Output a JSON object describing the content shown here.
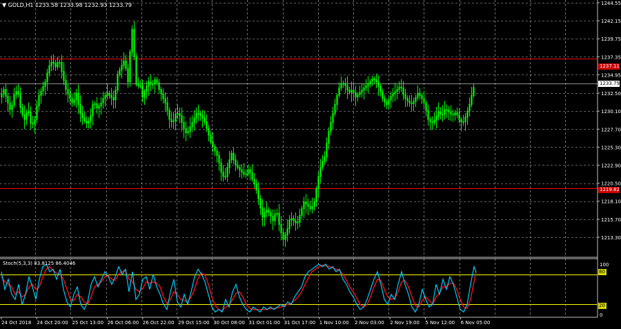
{
  "header": {
    "symbol_label": "GOLD,H1",
    "quotes": [
      "1233.58",
      "1233.98",
      "1232.93",
      "1233.79"
    ]
  },
  "stoch": {
    "label": "Stoch(5,3,3) 83.8125 86.4046",
    "levels": [
      80,
      20
    ],
    "level_labels": [
      "80",
      "20"
    ],
    "scale_labels": [
      "100",
      "0"
    ],
    "k_color": "#00ccff",
    "d_color": "#ff1010",
    "level_color": "#ffff00"
  },
  "colors": {
    "background": "#000000",
    "grid": "#c0c0c0",
    "candle": "#00ff00",
    "hline": "#ff0000"
  },
  "price_boxes": {
    "upper_red": "1237.11",
    "current": "1233.79",
    "lower_red": "1219.82"
  },
  "chart_data": {
    "type": "candlestick",
    "y_tick_labels": [
      "1244.55",
      "1242.15",
      "1239.75",
      "1237.35",
      "1234.95",
      "1232.50",
      "1230.10",
      "1227.70",
      "1225.30",
      "1222.90",
      "1220.50",
      "1218.10",
      "1215.70",
      "1213.30"
    ],
    "ylim": [
      1210.9,
      1244.55
    ],
    "x_tick_labels": [
      "24 Oct 2018",
      "24 Oct 20:00",
      "25 Oct 13:00",
      "26 Oct 06:00",
      "26 Oct 22:00",
      "29 Oct 15:00",
      "30 Oct 08:00",
      "31 Oct 01:00",
      "31 Oct 17:00",
      "1 Nov 10:00",
      "2 Nov 03:00",
      "2 Nov 19:00",
      "5 Nov 12:00",
      "6 Nov 05:00"
    ],
    "horizontal_lines": [
      1237.11,
      1219.82
    ],
    "current_price": 1233.79,
    "close_path": [
      [
        0,
        1232.0
      ],
      [
        5,
        1233.0
      ],
      [
        10,
        1231.5
      ],
      [
        15,
        1230.0
      ],
      [
        20,
        1232.3
      ],
      [
        25,
        1233.0
      ],
      [
        30,
        1230.0
      ],
      [
        35,
        1229.0
      ],
      [
        40,
        1230.5
      ],
      [
        45,
        1228.0
      ],
      [
        50,
        1229.0
      ],
      [
        55,
        1232.0
      ],
      [
        60,
        1233.0
      ],
      [
        65,
        1234.0
      ],
      [
        70,
        1236.0
      ],
      [
        75,
        1236.8
      ],
      [
        80,
        1236.0
      ],
      [
        85,
        1237.0
      ],
      [
        90,
        1235.0
      ],
      [
        95,
        1233.0
      ],
      [
        100,
        1232.0
      ],
      [
        105,
        1231.0
      ],
      [
        110,
        1232.5
      ],
      [
        115,
        1230.0
      ],
      [
        120,
        1229.0
      ],
      [
        125,
        1228.5
      ],
      [
        130,
        1229.0
      ],
      [
        135,
        1231.5
      ],
      [
        140,
        1230.5
      ],
      [
        145,
        1231.0
      ],
      [
        150,
        1232.0
      ],
      [
        155,
        1232.5
      ],
      [
        160,
        1232.0
      ],
      [
        165,
        1231.5
      ],
      [
        170,
        1235.0
      ],
      [
        175,
        1236.0
      ],
      [
        180,
        1237.0
      ],
      [
        185,
        1234.0
      ],
      [
        188,
        1238.0
      ],
      [
        192,
        1242.0
      ],
      [
        195,
        1235.0
      ],
      [
        198,
        1233.0
      ],
      [
        202,
        1234.0
      ],
      [
        206,
        1232.0
      ],
      [
        210,
        1233.0
      ],
      [
        215,
        1234.0
      ],
      [
        220,
        1233.5
      ],
      [
        225,
        1234.5
      ],
      [
        230,
        1233.0
      ],
      [
        235,
        1232.0
      ],
      [
        240,
        1231.0
      ],
      [
        245,
        1229.0
      ],
      [
        250,
        1228.5
      ],
      [
        255,
        1230.0
      ],
      [
        260,
        1229.5
      ],
      [
        265,
        1228.0
      ],
      [
        270,
        1227.0
      ],
      [
        275,
        1228.0
      ],
      [
        280,
        1229.0
      ],
      [
        285,
        1230.0
      ],
      [
        290,
        1229.5
      ],
      [
        295,
        1229.0
      ],
      [
        300,
        1227.5
      ],
      [
        305,
        1226.0
      ],
      [
        310,
        1225.0
      ],
      [
        315,
        1224.0
      ],
      [
        320,
        1222.0
      ],
      [
        325,
        1221.0
      ],
      [
        330,
        1223.0
      ],
      [
        335,
        1224.5
      ],
      [
        340,
        1223.0
      ],
      [
        345,
        1222.5
      ],
      [
        350,
        1222.0
      ],
      [
        355,
        1221.5
      ],
      [
        360,
        1222.5
      ],
      [
        365,
        1221.0
      ],
      [
        370,
        1220.0
      ],
      [
        375,
        1218.0
      ],
      [
        380,
        1216.0
      ],
      [
        385,
        1217.0
      ],
      [
        390,
        1216.5
      ],
      [
        395,
        1215.5
      ],
      [
        400,
        1217.0
      ],
      [
        405,
        1214.5
      ],
      [
        410,
        1213.0
      ],
      [
        415,
        1214.0
      ],
      [
        420,
        1216.0
      ],
      [
        425,
        1215.5
      ],
      [
        430,
        1215.0
      ],
      [
        435,
        1216.5
      ],
      [
        440,
        1218.0
      ],
      [
        445,
        1217.5
      ],
      [
        450,
        1217.0
      ],
      [
        455,
        1218.0
      ],
      [
        460,
        1221.0
      ],
      [
        465,
        1223.0
      ],
      [
        470,
        1224.0
      ],
      [
        475,
        1227.0
      ],
      [
        480,
        1229.0
      ],
      [
        485,
        1231.0
      ],
      [
        490,
        1233.0
      ],
      [
        495,
        1234.0
      ],
      [
        500,
        1233.5
      ],
      [
        505,
        1232.5
      ],
      [
        510,
        1233.0
      ],
      [
        515,
        1232.0
      ],
      [
        520,
        1232.5
      ],
      [
        525,
        1233.0
      ],
      [
        530,
        1233.5
      ],
      [
        535,
        1234.0
      ],
      [
        540,
        1234.5
      ],
      [
        545,
        1234.0
      ],
      [
        550,
        1233.0
      ],
      [
        555,
        1231.5
      ],
      [
        560,
        1231.0
      ],
      [
        565,
        1232.0
      ],
      [
        570,
        1232.5
      ],
      [
        575,
        1233.0
      ],
      [
        580,
        1233.5
      ],
      [
        585,
        1232.0
      ],
      [
        590,
        1231.5
      ],
      [
        595,
        1231.0
      ],
      [
        600,
        1231.5
      ],
      [
        605,
        1232.5
      ],
      [
        610,
        1232.0
      ],
      [
        615,
        1231.0
      ],
      [
        620,
        1229.0
      ],
      [
        625,
        1228.5
      ],
      [
        630,
        1229.0
      ],
      [
        635,
        1230.0
      ],
      [
        640,
        1229.5
      ],
      [
        645,
        1230.5
      ],
      [
        650,
        1230.0
      ],
      [
        655,
        1229.5
      ],
      [
        660,
        1230.0
      ],
      [
        665,
        1229.0
      ],
      [
        670,
        1228.5
      ],
      [
        675,
        1229.5
      ],
      [
        680,
        1231.0
      ],
      [
        685,
        1233.0
      ],
      [
        688,
        1233.79
      ]
    ],
    "stoch_k_path": [
      [
        0,
        85
      ],
      [
        5,
        50
      ],
      [
        10,
        70
      ],
      [
        15,
        40
      ],
      [
        20,
        30
      ],
      [
        25,
        60
      ],
      [
        30,
        20
      ],
      [
        35,
        40
      ],
      [
        40,
        75
      ],
      [
        45,
        55
      ],
      [
        50,
        30
      ],
      [
        55,
        70
      ],
      [
        60,
        95
      ],
      [
        65,
        100
      ],
      [
        70,
        85
      ],
      [
        75,
        90
      ],
      [
        80,
        70
      ],
      [
        85,
        90
      ],
      [
        90,
        50
      ],
      [
        95,
        25
      ],
      [
        100,
        15
      ],
      [
        105,
        40
      ],
      [
        110,
        55
      ],
      [
        115,
        20
      ],
      [
        120,
        10
      ],
      [
        125,
        25
      ],
      [
        130,
        60
      ],
      [
        135,
        75
      ],
      [
        140,
        55
      ],
      [
        145,
        70
      ],
      [
        150,
        85
      ],
      [
        155,
        75
      ],
      [
        160,
        60
      ],
      [
        165,
        75
      ],
      [
        170,
        95
      ],
      [
        175,
        80
      ],
      [
        180,
        90
      ],
      [
        185,
        45
      ],
      [
        190,
        85
      ],
      [
        195,
        30
      ],
      [
        200,
        40
      ],
      [
        205,
        70
      ],
      [
        210,
        75
      ],
      [
        215,
        50
      ],
      [
        220,
        80
      ],
      [
        225,
        55
      ],
      [
        230,
        40
      ],
      [
        235,
        20
      ],
      [
        240,
        10
      ],
      [
        245,
        45
      ],
      [
        250,
        70
      ],
      [
        255,
        25
      ],
      [
        260,
        15
      ],
      [
        265,
        40
      ],
      [
        270,
        20
      ],
      [
        275,
        45
      ],
      [
        280,
        75
      ],
      [
        285,
        90
      ],
      [
        290,
        80
      ],
      [
        295,
        65
      ],
      [
        300,
        40
      ],
      [
        305,
        15
      ],
      [
        310,
        5
      ],
      [
        315,
        10
      ],
      [
        320,
        5
      ],
      [
        325,
        30
      ],
      [
        330,
        15
      ],
      [
        335,
        45
      ],
      [
        340,
        60
      ],
      [
        345,
        35
      ],
      [
        350,
        20
      ],
      [
        355,
        10
      ],
      [
        360,
        5
      ],
      [
        365,
        15
      ],
      [
        370,
        10
      ],
      [
        375,
        5
      ],
      [
        380,
        15
      ],
      [
        385,
        10
      ],
      [
        390,
        15
      ],
      [
        395,
        10
      ],
      [
        400,
        15
      ],
      [
        405,
        20
      ],
      [
        410,
        15
      ],
      [
        415,
        25
      ],
      [
        420,
        20
      ],
      [
        425,
        35
      ],
      [
        430,
        45
      ],
      [
        435,
        55
      ],
      [
        440,
        75
      ],
      [
        445,
        85
      ],
      [
        450,
        90
      ],
      [
        455,
        95
      ],
      [
        460,
        100
      ],
      [
        465,
        95
      ],
      [
        470,
        100
      ],
      [
        475,
        90
      ],
      [
        480,
        95
      ],
      [
        485,
        85
      ],
      [
        490,
        90
      ],
      [
        495,
        70
      ],
      [
        500,
        60
      ],
      [
        505,
        45
      ],
      [
        510,
        35
      ],
      [
        515,
        20
      ],
      [
        520,
        10
      ],
      [
        525,
        15
      ],
      [
        530,
        30
      ],
      [
        535,
        50
      ],
      [
        540,
        70
      ],
      [
        545,
        85
      ],
      [
        550,
        60
      ],
      [
        555,
        30
      ],
      [
        560,
        20
      ],
      [
        565,
        40
      ],
      [
        570,
        30
      ],
      [
        575,
        60
      ],
      [
        580,
        85
      ],
      [
        585,
        60
      ],
      [
        590,
        40
      ],
      [
        595,
        15
      ],
      [
        600,
        5
      ],
      [
        605,
        20
      ],
      [
        610,
        50
      ],
      [
        615,
        30
      ],
      [
        620,
        15
      ],
      [
        625,
        20
      ],
      [
        630,
        60
      ],
      [
        635,
        40
      ],
      [
        640,
        70
      ],
      [
        645,
        50
      ],
      [
        650,
        75
      ],
      [
        655,
        60
      ],
      [
        660,
        35
      ],
      [
        665,
        10
      ],
      [
        670,
        5
      ],
      [
        675,
        20
      ],
      [
        680,
        60
      ],
      [
        685,
        95
      ],
      [
        688,
        84
      ]
    ],
    "stoch_d_path": [
      [
        0,
        75
      ],
      [
        5,
        65
      ],
      [
        10,
        60
      ],
      [
        15,
        55
      ],
      [
        20,
        40
      ],
      [
        25,
        45
      ],
      [
        30,
        35
      ],
      [
        35,
        40
      ],
      [
        40,
        55
      ],
      [
        45,
        60
      ],
      [
        50,
        50
      ],
      [
        55,
        55
      ],
      [
        60,
        75
      ],
      [
        65,
        90
      ],
      [
        70,
        95
      ],
      [
        75,
        88
      ],
      [
        80,
        82
      ],
      [
        85,
        80
      ],
      [
        90,
        70
      ],
      [
        95,
        50
      ],
      [
        100,
        30
      ],
      [
        105,
        28
      ],
      [
        110,
        40
      ],
      [
        115,
        35
      ],
      [
        120,
        25
      ],
      [
        125,
        20
      ],
      [
        130,
        35
      ],
      [
        135,
        55
      ],
      [
        140,
        60
      ],
      [
        145,
        65
      ],
      [
        150,
        75
      ],
      [
        155,
        78
      ],
      [
        160,
        70
      ],
      [
        165,
        68
      ],
      [
        170,
        80
      ],
      [
        175,
        85
      ],
      [
        180,
        88
      ],
      [
        185,
        70
      ],
      [
        190,
        65
      ],
      [
        195,
        50
      ],
      [
        200,
        45
      ],
      [
        205,
        52
      ],
      [
        210,
        65
      ],
      [
        215,
        62
      ],
      [
        220,
        65
      ],
      [
        225,
        62
      ],
      [
        230,
        55
      ],
      [
        235,
        35
      ],
      [
        240,
        22
      ],
      [
        245,
        30
      ],
      [
        250,
        45
      ],
      [
        255,
        40
      ],
      [
        260,
        30
      ],
      [
        265,
        28
      ],
      [
        270,
        25
      ],
      [
        275,
        35
      ],
      [
        280,
        50
      ],
      [
        285,
        72
      ],
      [
        290,
        82
      ],
      [
        295,
        78
      ],
      [
        300,
        60
      ],
      [
        305,
        35
      ],
      [
        310,
        18
      ],
      [
        315,
        10
      ],
      [
        320,
        7
      ],
      [
        325,
        15
      ],
      [
        330,
        18
      ],
      [
        335,
        30
      ],
      [
        340,
        42
      ],
      [
        345,
        45
      ],
      [
        350,
        35
      ],
      [
        355,
        20
      ],
      [
        360,
        12
      ],
      [
        365,
        10
      ],
      [
        370,
        10
      ],
      [
        375,
        10
      ],
      [
        380,
        10
      ],
      [
        385,
        10
      ],
      [
        390,
        12
      ],
      [
        395,
        12
      ],
      [
        400,
        13
      ],
      [
        405,
        15
      ],
      [
        410,
        18
      ],
      [
        415,
        20
      ],
      [
        420,
        22
      ],
      [
        425,
        28
      ],
      [
        430,
        35
      ],
      [
        435,
        45
      ],
      [
        440,
        60
      ],
      [
        445,
        72
      ],
      [
        450,
        85
      ],
      [
        455,
        90
      ],
      [
        460,
        95
      ],
      [
        465,
        98
      ],
      [
        470,
        97
      ],
      [
        475,
        95
      ],
      [
        480,
        93
      ],
      [
        485,
        90
      ],
      [
        490,
        88
      ],
      [
        495,
        80
      ],
      [
        500,
        68
      ],
      [
        505,
        55
      ],
      [
        510,
        45
      ],
      [
        515,
        32
      ],
      [
        520,
        20
      ],
      [
        525,
        15
      ],
      [
        530,
        20
      ],
      [
        535,
        35
      ],
      [
        540,
        55
      ],
      [
        545,
        70
      ],
      [
        550,
        68
      ],
      [
        555,
        50
      ],
      [
        560,
        35
      ],
      [
        565,
        30
      ],
      [
        570,
        32
      ],
      [
        575,
        45
      ],
      [
        580,
        65
      ],
      [
        585,
        68
      ],
      [
        590,
        55
      ],
      [
        595,
        35
      ],
      [
        600,
        18
      ],
      [
        605,
        15
      ],
      [
        610,
        28
      ],
      [
        615,
        35
      ],
      [
        620,
        28
      ],
      [
        625,
        20
      ],
      [
        630,
        35
      ],
      [
        635,
        42
      ],
      [
        640,
        55
      ],
      [
        645,
        55
      ],
      [
        650,
        62
      ],
      [
        655,
        62
      ],
      [
        660,
        50
      ],
      [
        665,
        30
      ],
      [
        670,
        15
      ],
      [
        675,
        12
      ],
      [
        680,
        30
      ],
      [
        685,
        65
      ],
      [
        688,
        86
      ]
    ]
  }
}
